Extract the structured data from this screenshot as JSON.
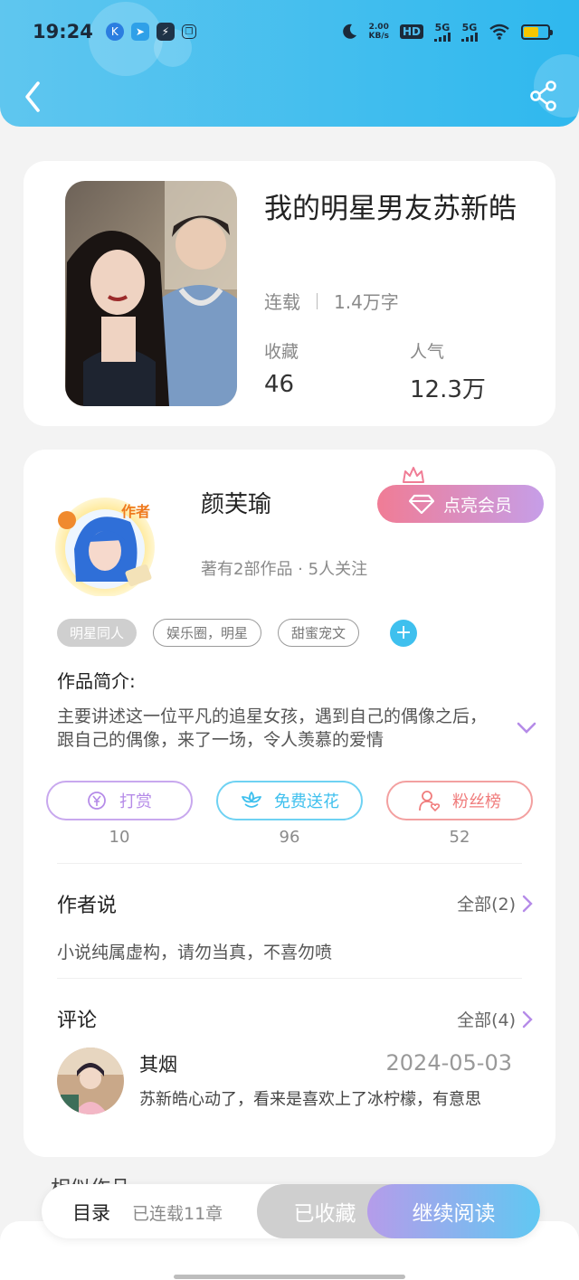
{
  "status_bar": {
    "time": "19:24",
    "net_speed_value": "2.00",
    "net_speed_unit": "KB/s",
    "hd_badge": "HD",
    "sim1": "5G",
    "sim2": "5G",
    "icons": [
      "k-app-icon",
      "paper-plane-icon",
      "bolt-app-icon",
      "copy-icon",
      "moon-icon",
      "wifi-icon",
      "battery-icon"
    ]
  },
  "header": {
    "back_icon": "chevron-left-icon",
    "share_icon": "share-icon"
  },
  "book": {
    "title": "我的明星男友苏新皓",
    "status": "连载",
    "word_count": "1.4万字",
    "favorites_label": "收藏",
    "favorites_value": "46",
    "popularity_label": "人气",
    "popularity_value": "12.3万"
  },
  "author": {
    "name": "颜芙瑜",
    "avatar_badge": "作者",
    "meta": "著有2部作品 · 5人关注",
    "vip_button": "点亮会员"
  },
  "tags": [
    "明星同人",
    "娱乐圈，明星",
    "甜蜜宠文"
  ],
  "intro": {
    "label": "作品简介:",
    "text": "主要讲述这一位平凡的追星女孩，遇到自己的偶像之后，跟自己的偶像，来了一场，令人羡慕的爱情"
  },
  "actions": [
    {
      "label": "打赏",
      "count": "10",
      "color": "#b58be8"
    },
    {
      "label": "免费送花",
      "count": "96",
      "color": "#3fc0ee"
    },
    {
      "label": "粉丝榜",
      "count": "52",
      "color": "#f07c7c"
    }
  ],
  "author_says": {
    "title": "作者说",
    "more": "全部(2)",
    "text": "小说纯属虚构，请勿当真，不喜勿喷"
  },
  "comments": {
    "title": "评论",
    "more": "全部(4)",
    "items": [
      {
        "user": "其烟",
        "date": "2024-05-03",
        "text": "苏新皓心动了，看来是喜欢上了冰柠檬，有意思"
      }
    ]
  },
  "peek_section": "相似作品",
  "bottom_bar": {
    "toc": "目录",
    "chapters": "已连载11章",
    "collected": "已收藏",
    "read": "继续阅读"
  },
  "colors": {
    "header_blue": "#2fb8ee",
    "accent_purple": "#b59cea",
    "vip_pink": "#f07c95"
  }
}
